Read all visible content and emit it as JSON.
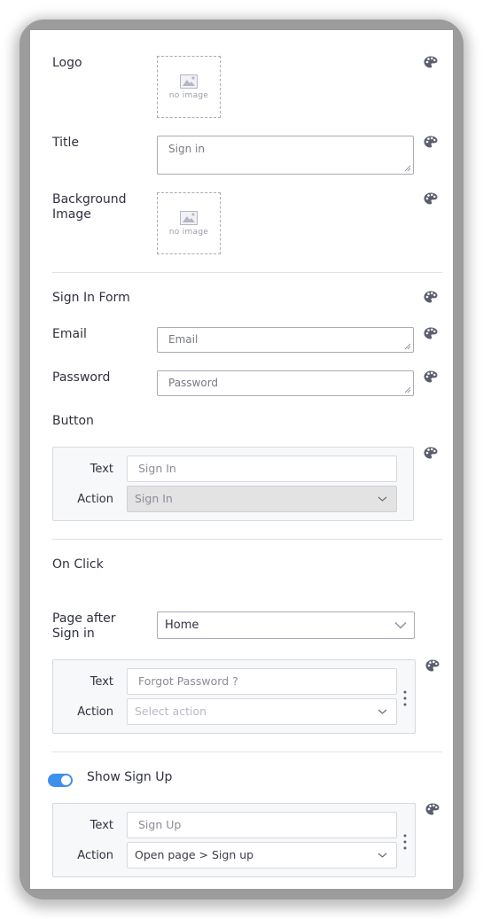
{
  "fields": {
    "logo": {
      "label": "Logo",
      "placeholder_text": "no image"
    },
    "title": {
      "label": "Title",
      "value": "Sign in"
    },
    "background": {
      "label_line1": "Background",
      "label_line2": "Image",
      "placeholder_text": "no image"
    }
  },
  "sign_in_form": {
    "heading": "Sign In Form",
    "email": {
      "label": "Email",
      "placeholder": "Email"
    },
    "password": {
      "label": "Password",
      "placeholder": "Password"
    },
    "button": {
      "heading": "Button",
      "text_label": "Text",
      "text_value": "Sign In",
      "action_label": "Action",
      "action_value": "Sign In"
    }
  },
  "on_click": {
    "heading": "On Click",
    "page_after_label_line1": "Page after",
    "page_after_label_line2": "Sign in",
    "page_after_value": "Home",
    "forgot": {
      "text_label": "Text",
      "text_value": "Forgot Password ?",
      "action_label": "Action",
      "action_placeholder": "Select action"
    }
  },
  "sign_up": {
    "toggle_label": "Show Sign Up",
    "toggle_on": true,
    "text_label": "Text",
    "text_value": "Sign Up",
    "action_label": "Action",
    "action_value": "Open page > Sign up"
  },
  "icons": {
    "style": "palette-icon",
    "image_placeholder": "image-icon",
    "more": "kebab-vertical-icon",
    "chevron": "chevron-down-icon",
    "resize": "resize-grip-icon"
  },
  "colors": {
    "toggle_accent": "#3f8fec",
    "icon_gray": "#5b5e6e",
    "frame_gray": "#9c9c9c"
  }
}
